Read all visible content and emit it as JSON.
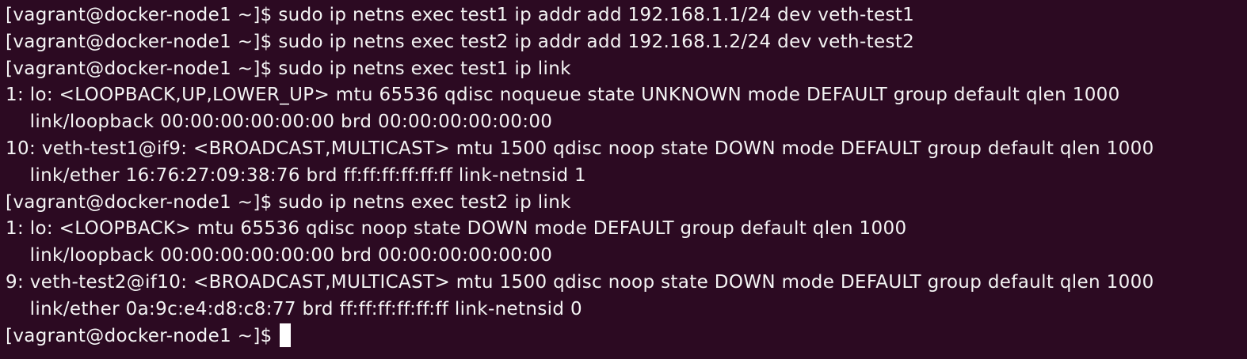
{
  "terminal": {
    "lines": [
      {
        "type": "prompt",
        "prompt": "[vagrant@docker-node1 ~]$ ",
        "command": "sudo ip netns exec test1 ip addr add 192.168.1.1/24 dev veth-test1"
      },
      {
        "type": "prompt",
        "prompt": "[vagrant@docker-node1 ~]$ ",
        "command": "sudo ip netns exec test2 ip addr add 192.168.1.2/24 dev veth-test2"
      },
      {
        "type": "prompt",
        "prompt": "[vagrant@docker-node1 ~]$ ",
        "command": "sudo ip netns exec test1 ip link"
      },
      {
        "type": "output",
        "text": "1: lo: <LOOPBACK,UP,LOWER_UP> mtu 65536 qdisc noqueue state UNKNOWN mode DEFAULT group default qlen 1000"
      },
      {
        "type": "output",
        "text": "    link/loopback 00:00:00:00:00:00 brd 00:00:00:00:00:00"
      },
      {
        "type": "output",
        "text": "10: veth-test1@if9: <BROADCAST,MULTICAST> mtu 1500 qdisc noop state DOWN mode DEFAULT group default qlen 1000"
      },
      {
        "type": "output",
        "text": "    link/ether 16:76:27:09:38:76 brd ff:ff:ff:ff:ff:ff link-netnsid 1"
      },
      {
        "type": "prompt",
        "prompt": "[vagrant@docker-node1 ~]$ ",
        "command": "sudo ip netns exec test2 ip link"
      },
      {
        "type": "output",
        "text": "1: lo: <LOOPBACK> mtu 65536 qdisc noop state DOWN mode DEFAULT group default qlen 1000"
      },
      {
        "type": "output",
        "text": "    link/loopback 00:00:00:00:00:00 brd 00:00:00:00:00:00"
      },
      {
        "type": "output",
        "text": "9: veth-test2@if10: <BROADCAST,MULTICAST> mtu 1500 qdisc noop state DOWN mode DEFAULT group default qlen 1000"
      },
      {
        "type": "output",
        "text": "    link/ether 0a:9c:e4:d8:c8:77 brd ff:ff:ff:ff:ff:ff link-netnsid 0"
      }
    ],
    "active_prompt": "[vagrant@docker-node1 ~]$ ",
    "colors": {
      "background": "#2c0a22",
      "foreground": "#f4f4f4",
      "cursor": "#ffffff"
    }
  }
}
